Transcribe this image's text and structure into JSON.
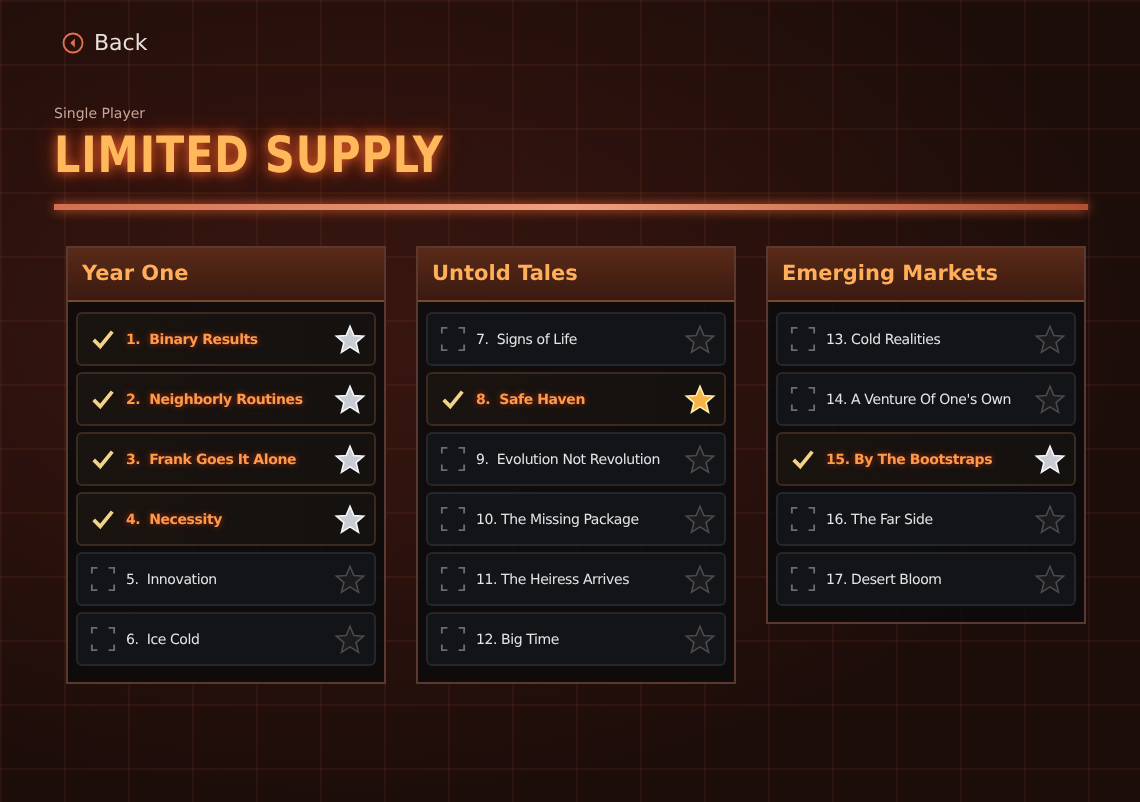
{
  "back": {
    "label": "Back"
  },
  "subtitle": "Single Player",
  "title": "LIMITED SUPPLY",
  "chapters": [
    {
      "title": "Year One",
      "missions": [
        {
          "label": "1.  Binary Results",
          "completed": true,
          "star_earned": true,
          "star_gold": false
        },
        {
          "label": "2.  Neighborly Routines",
          "completed": true,
          "star_earned": true,
          "star_gold": false
        },
        {
          "label": "3.  Frank Goes It Alone",
          "completed": true,
          "star_earned": true,
          "star_gold": false
        },
        {
          "label": "4.  Necessity",
          "completed": true,
          "star_earned": true,
          "star_gold": false
        },
        {
          "label": "5.  Innovation",
          "completed": false,
          "star_earned": false
        },
        {
          "label": "6.  Ice Cold",
          "completed": false,
          "star_earned": false
        }
      ]
    },
    {
      "title": "Untold Tales",
      "missions": [
        {
          "label": "7.  Signs of Life",
          "completed": false,
          "star_earned": false
        },
        {
          "label": "8.  Safe Haven",
          "completed": true,
          "star_earned": true,
          "star_gold": true
        },
        {
          "label": "9.  Evolution Not Revolution",
          "completed": false,
          "star_earned": false
        },
        {
          "label": "10. The Missing Package",
          "completed": false,
          "star_earned": false
        },
        {
          "label": "11. The Heiress Arrives",
          "completed": false,
          "star_earned": false
        },
        {
          "label": "12. Big Time",
          "completed": false,
          "star_earned": false
        }
      ]
    },
    {
      "title": "Emerging Markets",
      "missions": [
        {
          "label": "13. Cold Realities",
          "completed": false,
          "star_earned": false
        },
        {
          "label": "14. A Venture Of One's Own",
          "completed": false,
          "star_earned": false
        },
        {
          "label": "15. By The Bootstraps",
          "completed": true,
          "star_earned": true,
          "star_gold": false
        },
        {
          "label": "16. The Far Side",
          "completed": false,
          "star_earned": false
        },
        {
          "label": "17. Desert Bloom",
          "completed": false,
          "star_earned": false
        }
      ]
    }
  ]
}
